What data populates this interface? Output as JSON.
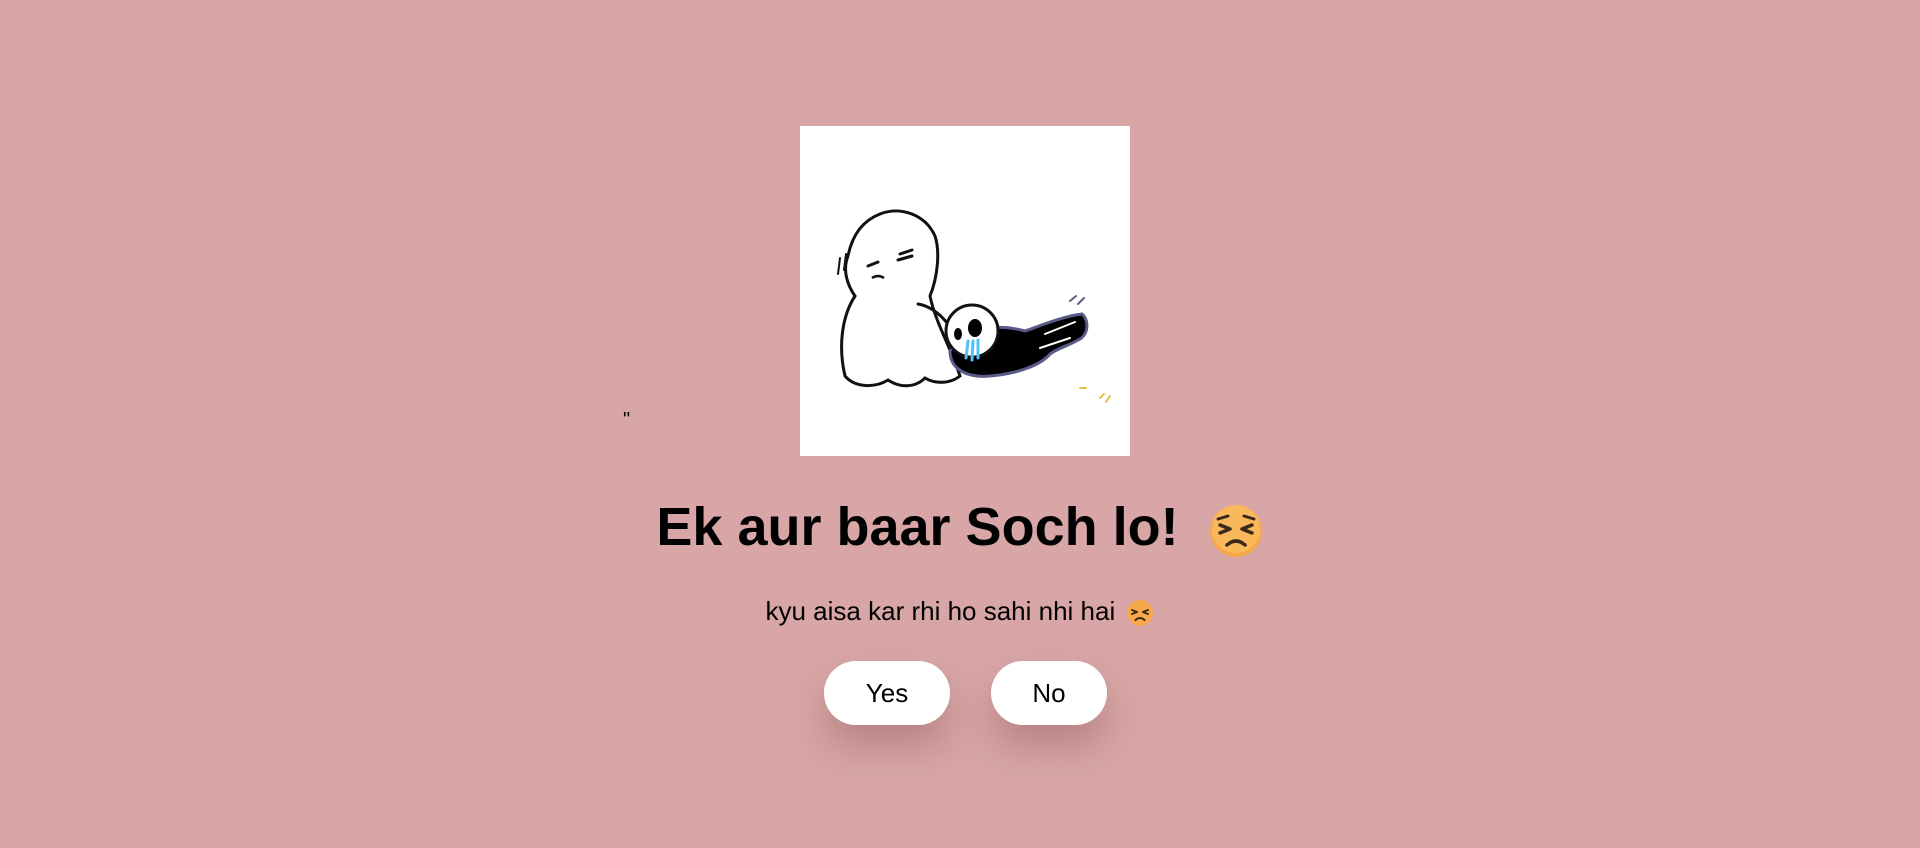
{
  "stray_text": "\"",
  "image": {
    "description_icon": "crying-skeleton-ghost-sticker"
  },
  "heading": {
    "text": "Ek aur baar Soch lo!",
    "emoji_icon": "persevering-face-emoji"
  },
  "subheading": {
    "text": "kyu aisa kar rhi ho sahi nhi hai",
    "emoji_icon": "persevering-face-emoji"
  },
  "buttons": {
    "yes_label": "Yes",
    "no_label": "No"
  },
  "colors": {
    "background": "#d8a6a6",
    "button_bg": "#ffffff",
    "text": "#000000",
    "emoji_face": "#f7a84a"
  }
}
